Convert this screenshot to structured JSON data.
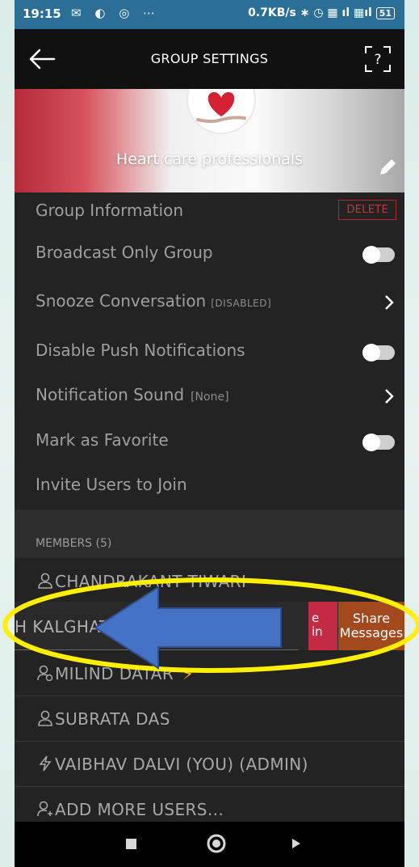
{
  "status_bar": {
    "time": "19:15",
    "network_speed": "0.7KB/s",
    "battery": "51"
  },
  "header": {
    "title": "GROUP SETTINGS"
  },
  "banner": {
    "group_name": "Heart care professionals"
  },
  "settings": [
    {
      "label": "Group Information",
      "control": "delete-button",
      "action_label": "DELETE"
    },
    {
      "label": "Broadcast Only Group",
      "control": "toggle",
      "on": false
    },
    {
      "label": "Snooze Conversation",
      "tag": "[DISABLED]",
      "control": "chevron"
    },
    {
      "label": "Disable Push Notifications",
      "control": "toggle",
      "on": false
    },
    {
      "label": "Notification Sound",
      "tag": "[None]",
      "control": "chevron"
    },
    {
      "label": "Mark as Favorite",
      "control": "toggle",
      "on": false
    },
    {
      "label": "Invite Users to Join"
    }
  ],
  "members": {
    "title": "MEMBERS (5)",
    "rows": [
      {
        "name": "CHANDRAKANT TIWARI",
        "icon": "user-icon"
      },
      {
        "name": "H KALGHATGI",
        "icon": "user-icon",
        "swiped": true,
        "actions": [
          {
            "label": "e\nin",
            "color": "#c42a42"
          },
          {
            "label": "Share\nMessages",
            "color": "#a24a1d"
          }
        ]
      },
      {
        "name": "MILIND DATAR",
        "icon": "user-sync-icon",
        "badge": "⚡"
      },
      {
        "name": "SUBRATA DAS",
        "icon": "user-icon"
      },
      {
        "name": "VAIBHAV  DALVI  (YOU)  (ADMIN)",
        "icon": "bolt-icon"
      },
      {
        "name": "ADD MORE USERS...",
        "icon": "add-user-icon"
      }
    ]
  },
  "colors": {
    "status_bar": "#2b6f97",
    "header": "#111111",
    "surface": "#232323",
    "delete_red": "#cf3340",
    "annotation_ellipse": "#ffef00",
    "annotation_arrow": "#4472c4"
  }
}
